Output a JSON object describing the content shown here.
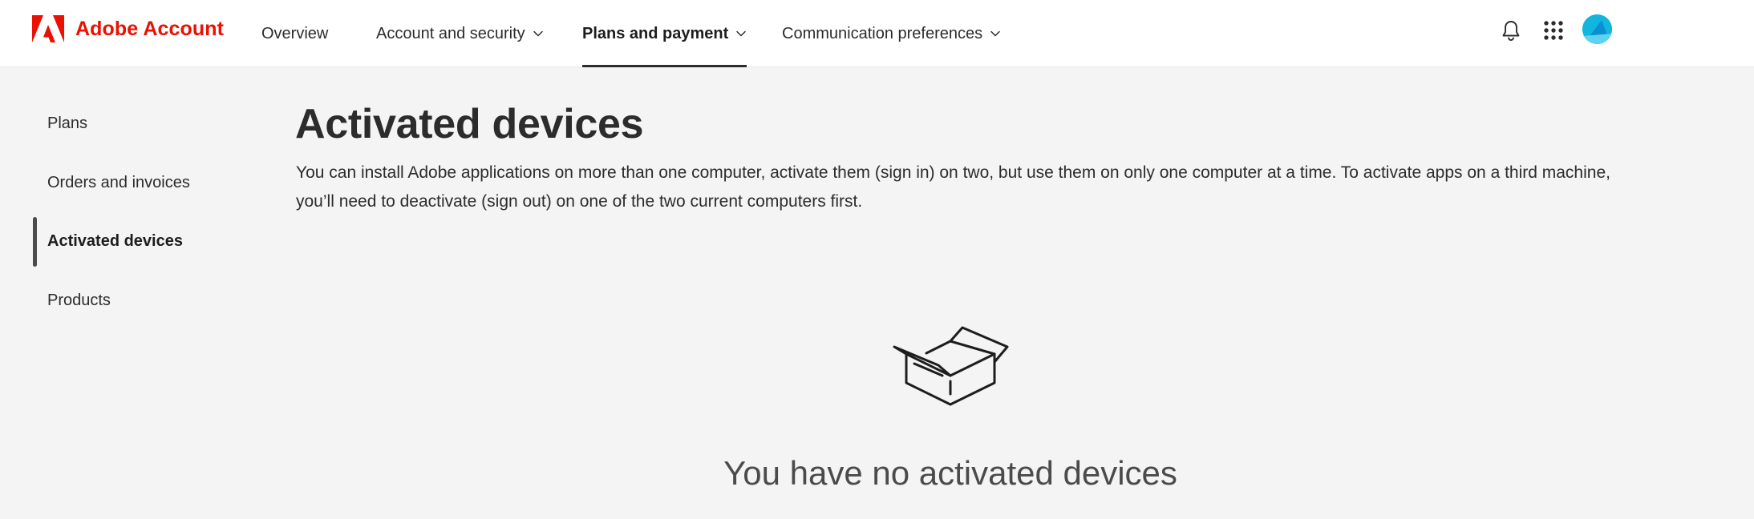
{
  "header": {
    "brand_name": "Adobe Account",
    "brand_color": "#eb1000",
    "nav": [
      {
        "label": "Overview",
        "has_dropdown": false,
        "active": false
      },
      {
        "label": "Account and security",
        "has_dropdown": true,
        "active": false
      },
      {
        "label": "Plans and payment",
        "has_dropdown": true,
        "active": true
      },
      {
        "label": "Communication preferences",
        "has_dropdown": true,
        "active": false
      }
    ],
    "icons": [
      "bell-icon",
      "apps-grid-icon",
      "avatar"
    ],
    "avatar_color": "#11b5e0"
  },
  "sidebar": {
    "items": [
      {
        "label": "Plans",
        "active": false
      },
      {
        "label": "Orders and invoices",
        "active": false
      },
      {
        "label": "Activated devices",
        "active": true
      },
      {
        "label": "Products",
        "active": false
      }
    ]
  },
  "main": {
    "title": "Activated devices",
    "description": "You can install Adobe applications on more than one computer, activate them (sign in) on two, but use them on only one computer at a time. To activate apps on a third machine, you’ll need to deactivate (sign out) on one of the two current computers first.",
    "empty_state": {
      "icon": "open-box-icon",
      "message": "You have no activated devices"
    }
  }
}
